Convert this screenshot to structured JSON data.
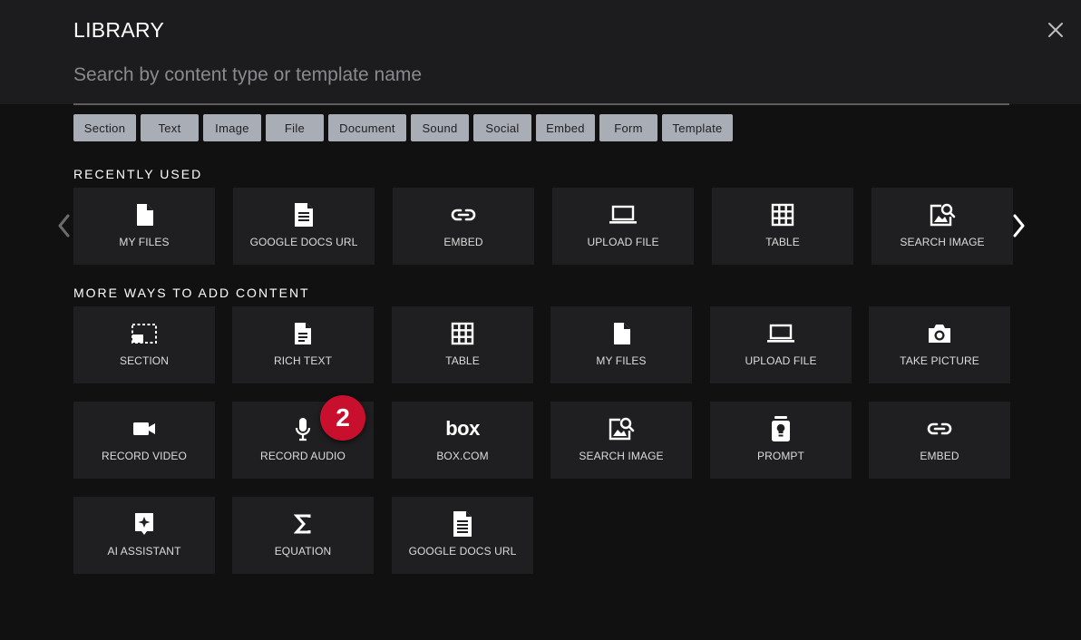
{
  "header": {
    "title": "LIBRARY",
    "search_placeholder": "Search by content type or template name"
  },
  "filters": [
    "Section",
    "Text",
    "Image",
    "File",
    "Document",
    "Sound",
    "Social",
    "Embed",
    "Form",
    "Template"
  ],
  "recently_used": {
    "label": "RECENTLY USED",
    "items": [
      "MY FILES",
      "GOOGLE DOCS URL",
      "EMBED",
      "UPLOAD FILE",
      "TABLE",
      "SEARCH IMAGE"
    ]
  },
  "more_ways": {
    "label": "MORE WAYS TO ADD CONTENT",
    "items": [
      "SECTION",
      "RICH TEXT",
      "TABLE",
      "MY FILES",
      "UPLOAD FILE",
      "TAKE PICTURE",
      "RECORD VIDEO",
      "RECORD AUDIO",
      "BOX.COM",
      "SEARCH IMAGE",
      "PROMPT",
      "EMBED",
      "AI ASSISTANT",
      "EQUATION",
      "GOOGLE DOCS URL"
    ]
  },
  "badge": "2",
  "box_logo_text": "box",
  "colors": {
    "background": "#111112",
    "header": "#1c1c1e",
    "tile": "#1f1f21",
    "chip": "#a9adb5",
    "badge": "#c8102e"
  }
}
